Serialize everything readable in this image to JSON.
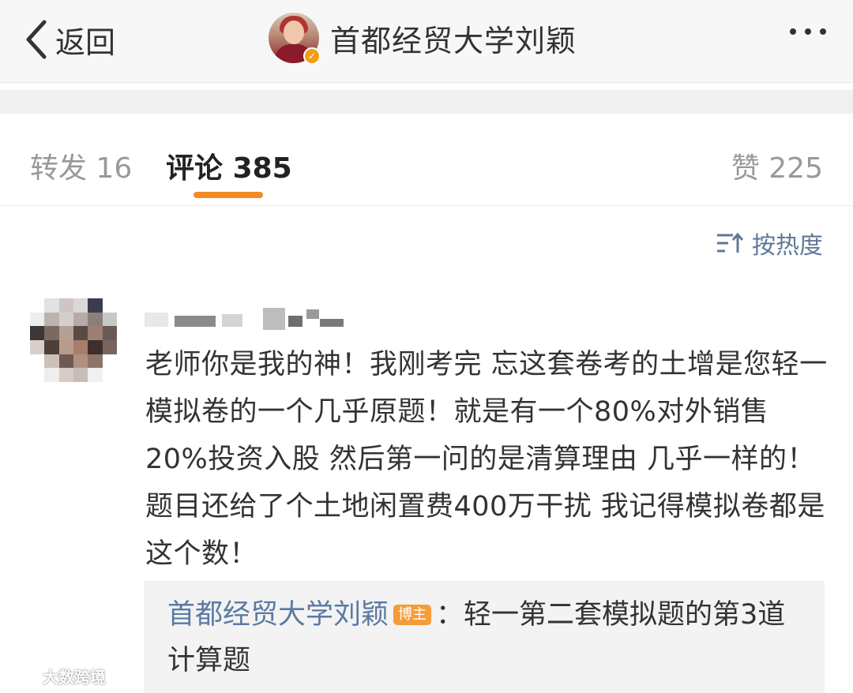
{
  "nav": {
    "back_label": "返回",
    "title": "首都经贸大学刘颖"
  },
  "tabs": {
    "repost_label": "转发",
    "repost_count": "16",
    "comment_label": "评论",
    "comment_count": "385",
    "like_label": "赞",
    "like_count": "225"
  },
  "sort": {
    "label": "按热度"
  },
  "comment": {
    "text": "老师你是我的神！我刚考完 忘这套卷考的土增是您轻一模拟卷的一个几乎原题！就是有一个80%对外销售 20%投资入股 然后第一问的是清算理由 几乎一样的！题目还给了个土地闲置费400万干扰 我记得模拟卷都是这个数！"
  },
  "reply": {
    "author": "首都经贸大学刘颖",
    "badge": "博主",
    "text": "：轻一第二套模拟题的第3道计算题"
  },
  "watermark": {
    "text": "大数跨境"
  },
  "colors": {
    "accent": "#f28c28",
    "link": "#5a7aa3",
    "verified": "#f69b17",
    "badge": "#f59c3a"
  }
}
